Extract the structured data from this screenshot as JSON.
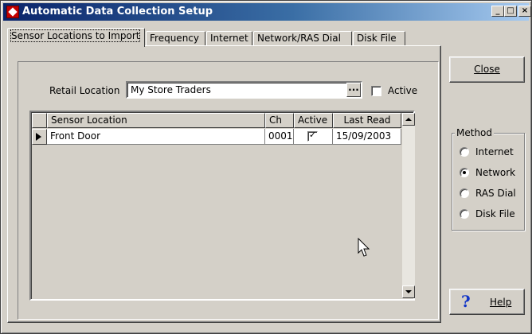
{
  "window": {
    "title": "Automatic Data Collection Setup",
    "controls": [
      "_",
      "□",
      "×"
    ]
  },
  "tabs": [
    {
      "label": "Sensor Locations to Import",
      "active": true
    },
    {
      "label": "Frequency",
      "active": false
    },
    {
      "label": "Internet",
      "active": false
    },
    {
      "label": "Network/RAS Dial",
      "active": false
    },
    {
      "label": "Disk File",
      "active": false
    }
  ],
  "form": {
    "retail_location_label": "Retail Location",
    "retail_location_value": "My Store Traders",
    "ellipsis_label": "...",
    "active_label": "Active",
    "active_checked": false
  },
  "grid": {
    "columns": [
      "Sensor Location",
      "Ch",
      "Active",
      "Last Read"
    ],
    "rows": [
      {
        "sensor_location": "Front Door",
        "ch": "0001",
        "active": true,
        "active_mark": "✓",
        "last_read": "15/09/2003"
      }
    ]
  },
  "buttons": {
    "close_label": "Close",
    "help_label": "Help",
    "help_icon": "?"
  },
  "method": {
    "title": "Method",
    "options": [
      {
        "label": "Internet",
        "selected": false
      },
      {
        "label": "Network",
        "selected": true
      },
      {
        "label": "RAS Dial",
        "selected": false
      },
      {
        "label": "Disk File",
        "selected": false
      }
    ]
  },
  "colors": {
    "face": "#d4d0c8",
    "title_start": "#0a246a",
    "title_end": "#a6caf0",
    "help_icon": "#1034c8"
  }
}
